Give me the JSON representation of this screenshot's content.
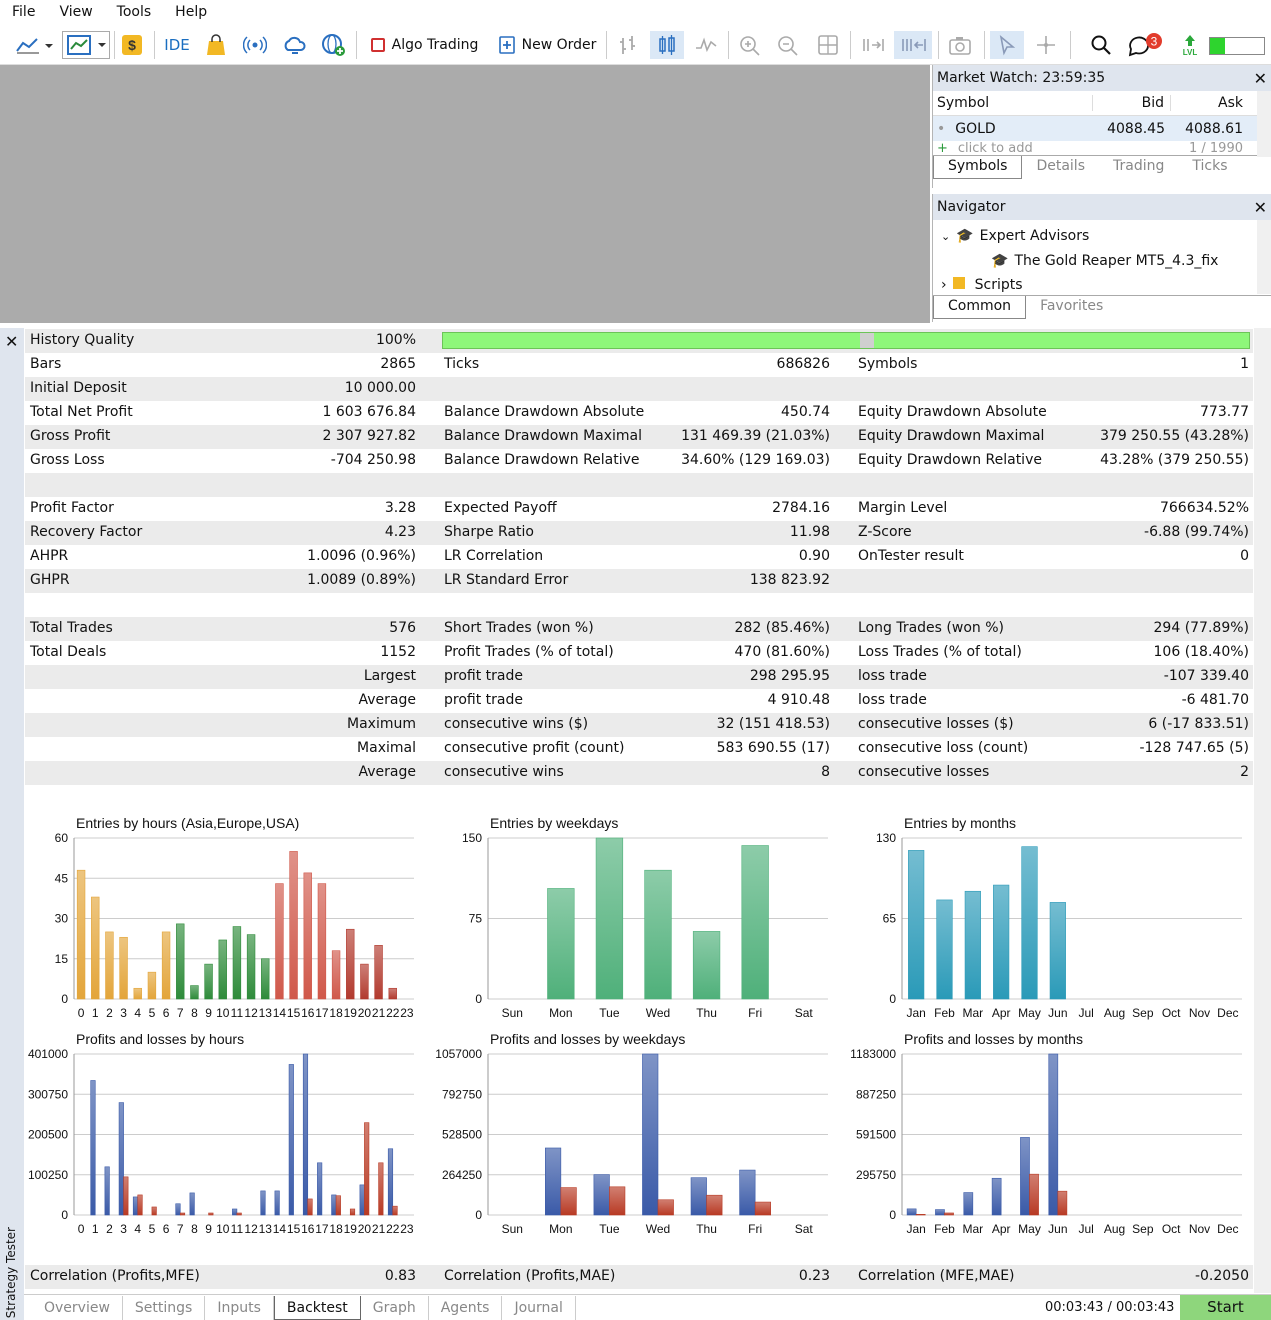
{
  "menu": [
    "File",
    "View",
    "Tools",
    "Help"
  ],
  "toolbar": {
    "ide": "IDE",
    "algo": "Algo Trading",
    "new_order": "New Order",
    "notif": "3",
    "lvl": "LVL"
  },
  "market_watch": {
    "title": "Market Watch: 23:59:35",
    "cols": [
      "Symbol",
      "Bid",
      "Ask"
    ],
    "row": {
      "symbol": "GOLD",
      "bid": "4088.45",
      "ask": "4088.61"
    },
    "add": "click to add",
    "count": "1 / 1990",
    "tabs": [
      "Symbols",
      "Details",
      "Trading",
      "Ticks"
    ]
  },
  "navigator": {
    "title": "Navigator",
    "items": [
      "Expert Advisors",
      "The Gold Reaper MT5_4.3_fix",
      "Scripts"
    ],
    "tabs": [
      "Common",
      "Favorites"
    ]
  },
  "side_label": "Strategy Tester",
  "rows": [
    {
      "a": [
        "History Quality",
        "100%"
      ]
    },
    {
      "a": [
        "Bars",
        "2865"
      ],
      "b": [
        "Ticks",
        "686826"
      ],
      "c": [
        "Symbols",
        "1"
      ]
    },
    {
      "a": [
        "Initial Deposit",
        "10 000.00"
      ]
    },
    {
      "a": [
        "Total Net Profit",
        "1 603 676.84"
      ],
      "b": [
        "Balance Drawdown Absolute",
        "450.74"
      ],
      "c": [
        "Equity Drawdown Absolute",
        "773.77"
      ]
    },
    {
      "a": [
        "Gross Profit",
        "2 307 927.82"
      ],
      "b": [
        "Balance Drawdown Maximal",
        "131 469.39 (21.03%)"
      ],
      "c": [
        "Equity Drawdown Maximal",
        "379 250.55 (43.28%)"
      ]
    },
    {
      "a": [
        "Gross Loss",
        "-704 250.98"
      ],
      "b": [
        "Balance Drawdown Relative",
        "34.60% (129 169.03)"
      ],
      "c": [
        "Equity Drawdown Relative",
        "43.28% (379 250.55)"
      ]
    },
    {},
    {
      "a": [
        "Profit Factor",
        "3.28"
      ],
      "b": [
        "Expected Payoff",
        "2784.16"
      ],
      "c": [
        "Margin Level",
        "766634.52%"
      ]
    },
    {
      "a": [
        "Recovery Factor",
        "4.23"
      ],
      "b": [
        "Sharpe Ratio",
        "11.98"
      ],
      "c": [
        "Z-Score",
        "-6.88 (99.74%)"
      ]
    },
    {
      "a": [
        "AHPR",
        "1.0096 (0.96%)"
      ],
      "b": [
        "LR Correlation",
        "0.90"
      ],
      "c": [
        "OnTester result",
        "0"
      ]
    },
    {
      "a": [
        "GHPR",
        "1.0089 (0.89%)"
      ],
      "b": [
        "LR Standard Error",
        "138 823.92"
      ]
    },
    {},
    {
      "a": [
        "Total Trades",
        "576"
      ],
      "b": [
        "Short Trades (won %)",
        "282 (85.46%)"
      ],
      "c": [
        "Long Trades (won %)",
        "294 (77.89%)"
      ]
    },
    {
      "a": [
        "Total Deals",
        "1152"
      ],
      "b": [
        "Profit Trades (% of total)",
        "470 (81.60%)"
      ],
      "c": [
        "Loss Trades (% of total)",
        "106 (18.40%)"
      ]
    },
    {
      "a": [
        "",
        "Largest"
      ],
      "b": [
        "profit trade",
        "298 295.95"
      ],
      "c": [
        "loss trade",
        "-107 339.40"
      ]
    },
    {
      "a": [
        "",
        "Average"
      ],
      "b": [
        "profit trade",
        "4 910.48"
      ],
      "c": [
        "loss trade",
        "-6 481.70"
      ]
    },
    {
      "a": [
        "",
        "Maximum"
      ],
      "b": [
        "consecutive wins ($)",
        "32 (151 418.53)"
      ],
      "c": [
        "consecutive losses ($)",
        "6 (-17 833.51)"
      ]
    },
    {
      "a": [
        "",
        "Maximal"
      ],
      "b": [
        "consecutive profit (count)",
        "583 690.55 (17)"
      ],
      "c": [
        "consecutive loss (count)",
        "-128 747.65 (5)"
      ]
    },
    {
      "a": [
        "",
        "Average"
      ],
      "b": [
        "consecutive wins",
        "8"
      ],
      "c": [
        "consecutive losses",
        "2"
      ]
    },
    {}
  ],
  "correlation": {
    "a": [
      "Correlation (Profits,MFE)",
      "0.83"
    ],
    "b": [
      "Correlation (Profits,MAE)",
      "0.23"
    ],
    "c": [
      "Correlation (MFE,MAE)",
      "-0.2050"
    ]
  },
  "bottom_tabs": [
    "Overview",
    "Settings",
    "Inputs",
    "Backtest",
    "Graph",
    "Agents",
    "Journal"
  ],
  "time": "00:03:43 / 00:03:43",
  "start": "Start",
  "chart_data": [
    {
      "type": "bar",
      "title": "Entries by hours (Asia,Europe,USA)",
      "categories": [
        "0",
        "1",
        "2",
        "3",
        "4",
        "5",
        "6",
        "7",
        "8",
        "9",
        "10",
        "11",
        "12",
        "13",
        "14",
        "15",
        "16",
        "17",
        "18",
        "19",
        "20",
        "21",
        "22",
        "23"
      ],
      "values": [
        48,
        38,
        25,
        23,
        4,
        10,
        25,
        28,
        5,
        13,
        22,
        27,
        24,
        15,
        43,
        55,
        47,
        43,
        18,
        26,
        13,
        20,
        4,
        0
      ],
      "ylim": [
        0,
        60
      ],
      "yticks": [
        "0",
        "15",
        "30",
        "45",
        "60"
      ],
      "colors": [
        "#e3a53a",
        "#e3a53a",
        "#e3a53a",
        "#e3a53a",
        "#e3a53a",
        "#e3a53a",
        "#e3a53a",
        "#2e8b3a",
        "#2e8b3a",
        "#2e8b3a",
        "#2e8b3a",
        "#2e8b3a",
        "#2e8b3a",
        "#2e8b3a",
        "#d0584a",
        "#d0584a",
        "#d0584a",
        "#d0584a",
        "#d0584a",
        "#b23a2e",
        "#b23a2e",
        "#b23a2e",
        "#b23a2e",
        "#b23a2e"
      ]
    },
    {
      "type": "bar",
      "title": "Entries by weekdays",
      "categories": [
        "Sun",
        "Mon",
        "Tue",
        "Wed",
        "Thu",
        "Fri",
        "Sat"
      ],
      "values": [
        0,
        103,
        150,
        120,
        63,
        143,
        0
      ],
      "ylim": [
        0,
        150
      ],
      "yticks": [
        "0",
        "75",
        "150"
      ],
      "color": "#4fb07a"
    },
    {
      "type": "bar",
      "title": "Entries by months",
      "categories": [
        "Jan",
        "Feb",
        "Mar",
        "Apr",
        "May",
        "Jun",
        "Jul",
        "Aug",
        "Sep",
        "Oct",
        "Nov",
        "Dec"
      ],
      "values": [
        120,
        80,
        87,
        92,
        123,
        78,
        0,
        0,
        0,
        0,
        0,
        0
      ],
      "ylim": [
        0,
        130
      ],
      "yticks": [
        "0",
        "65",
        "130"
      ],
      "color": "#2a9ab8"
    },
    {
      "type": "bar",
      "title": "Profits and losses by hours",
      "categories": [
        "0",
        "1",
        "2",
        "3",
        "4",
        "5",
        "6",
        "7",
        "8",
        "9",
        "10",
        "11",
        "12",
        "13",
        "14",
        "15",
        "16",
        "17",
        "18",
        "19",
        "20",
        "21",
        "22",
        "23"
      ],
      "series": [
        {
          "values": [
            0,
            335000,
            120000,
            280000,
            45000,
            0,
            0,
            28000,
            55000,
            0,
            0,
            15000,
            0,
            60000,
            60000,
            375000,
            401000,
            130000,
            50000,
            0,
            75000,
            0,
            165000,
            0
          ],
          "color": "#3a5aa8"
        },
        {
          "values": [
            0,
            0,
            0,
            95000,
            50000,
            20000,
            0,
            5000,
            0,
            5000,
            0,
            5000,
            0,
            0,
            0,
            0,
            40000,
            0,
            48000,
            15000,
            230000,
            130000,
            22000,
            0
          ],
          "color": "#b83a24"
        }
      ],
      "ylim": [
        0,
        401000
      ],
      "yticks": [
        "0",
        "100250",
        "200500",
        "300750",
        "401000"
      ]
    },
    {
      "type": "bar",
      "title": "Profits and losses by weekdays",
      "categories": [
        "Sun",
        "Mon",
        "Tue",
        "Wed",
        "Thu",
        "Fri",
        "Sat"
      ],
      "series": [
        {
          "values": [
            0,
            440000,
            265000,
            1057000,
            245000,
            295000,
            0
          ],
          "color": "#3a5aa8"
        },
        {
          "values": [
            0,
            180000,
            185000,
            100000,
            130000,
            85000,
            0
          ],
          "color": "#b83a24"
        }
      ],
      "ylim": [
        0,
        1057000
      ],
      "yticks": [
        "0",
        "264250",
        "528500",
        "792750",
        "1057000"
      ]
    },
    {
      "type": "bar",
      "title": "Profits and losses by months",
      "categories": [
        "Jan",
        "Feb",
        "Mar",
        "Apr",
        "May",
        "Jun",
        "Jul",
        "Aug",
        "Sep",
        "Oct",
        "Nov",
        "Dec"
      ],
      "series": [
        {
          "values": [
            45000,
            40000,
            165000,
            270000,
            570000,
            1183000,
            0,
            0,
            0,
            0,
            0,
            0
          ],
          "color": "#3a5aa8"
        },
        {
          "values": [
            5000,
            15000,
            0,
            0,
            300000,
            175000,
            0,
            0,
            0,
            0,
            0,
            0
          ],
          "color": "#b83a24"
        }
      ],
      "ylim": [
        0,
        1183000
      ],
      "yticks": [
        "0",
        "295750",
        "591500",
        "887250",
        "1183000"
      ]
    }
  ]
}
